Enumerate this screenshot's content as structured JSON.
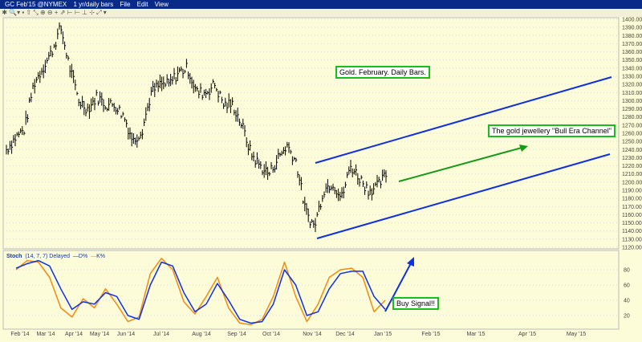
{
  "window": {
    "symbol": "GC Feb'15 @NYMEX",
    "period": "1 yr/daily bars",
    "menu": [
      "File",
      "Edit",
      "View"
    ]
  },
  "stoch_label": {
    "name": "Stoch",
    "params": "(14, 7, 7) Delayed",
    "d": "D%",
    "k": "K%"
  },
  "annotations": {
    "title": "Gold. February. Daily Bars.",
    "channel": "The gold jewellery \"Bull Era Channel\"",
    "signal": "Buy Signal!!"
  },
  "chart_data": [
    {
      "type": "bar",
      "title": "Gold. February. Daily Bars.",
      "ylim": [
        1120,
        1400
      ],
      "yticks": [
        1400,
        1390,
        1380,
        1370,
        1360,
        1350,
        1340,
        1330,
        1320,
        1310,
        1300,
        1290,
        1280,
        1270,
        1260,
        1250,
        1240,
        1230,
        1220,
        1210,
        1200,
        1190,
        1180,
        1170,
        1160,
        1150,
        1140,
        1130,
        1120
      ],
      "xticks": [
        "Feb '14",
        "Mar '14",
        "Apr '14",
        "May '14",
        "Jun '14",
        "Jul '14",
        "Aug '14",
        "Sep '14",
        "Oct '14",
        "Nov '14",
        "Dec '14",
        "Jan '15",
        "Feb '15",
        "Mar '15",
        "Apr '15",
        "May '15"
      ],
      "price_path": [
        1240,
        1255,
        1265,
        1320,
        1340,
        1360,
        1390,
        1340,
        1300,
        1290,
        1305,
        1295,
        1295,
        1280,
        1250,
        1265,
        1310,
        1320,
        1320,
        1335,
        1340,
        1310,
        1310,
        1320,
        1295,
        1295,
        1270,
        1235,
        1220,
        1210,
        1230,
        1245,
        1225,
        1165,
        1145,
        1190,
        1200,
        1180,
        1220,
        1205,
        1190,
        1195,
        1210
      ]
    },
    {
      "type": "line",
      "name": "Stoch",
      "ylim": [
        0,
        100
      ],
      "yticks": [
        80,
        60,
        40,
        20
      ],
      "series": [
        {
          "name": "D%",
          "color": "#1030e0",
          "values": [
            82,
            88,
            92,
            85,
            55,
            28,
            38,
            35,
            50,
            45,
            20,
            15,
            60,
            90,
            85,
            50,
            25,
            35,
            62,
            40,
            15,
            10,
            12,
            35,
            80,
            60,
            20,
            25,
            55,
            75,
            78,
            78,
            45,
            28
          ]
        },
        {
          "name": "K%",
          "color": "#f08a10",
          "values": [
            80,
            92,
            90,
            70,
            30,
            18,
            42,
            30,
            55,
            35,
            12,
            18,
            75,
            95,
            80,
            38,
            22,
            45,
            70,
            30,
            10,
            8,
            15,
            45,
            90,
            45,
            12,
            35,
            70,
            80,
            82,
            70,
            25,
            40
          ]
        }
      ]
    }
  ],
  "colors": {
    "channel": "#1030e0",
    "arrow_green": "#159a15",
    "bars": "#000000"
  }
}
